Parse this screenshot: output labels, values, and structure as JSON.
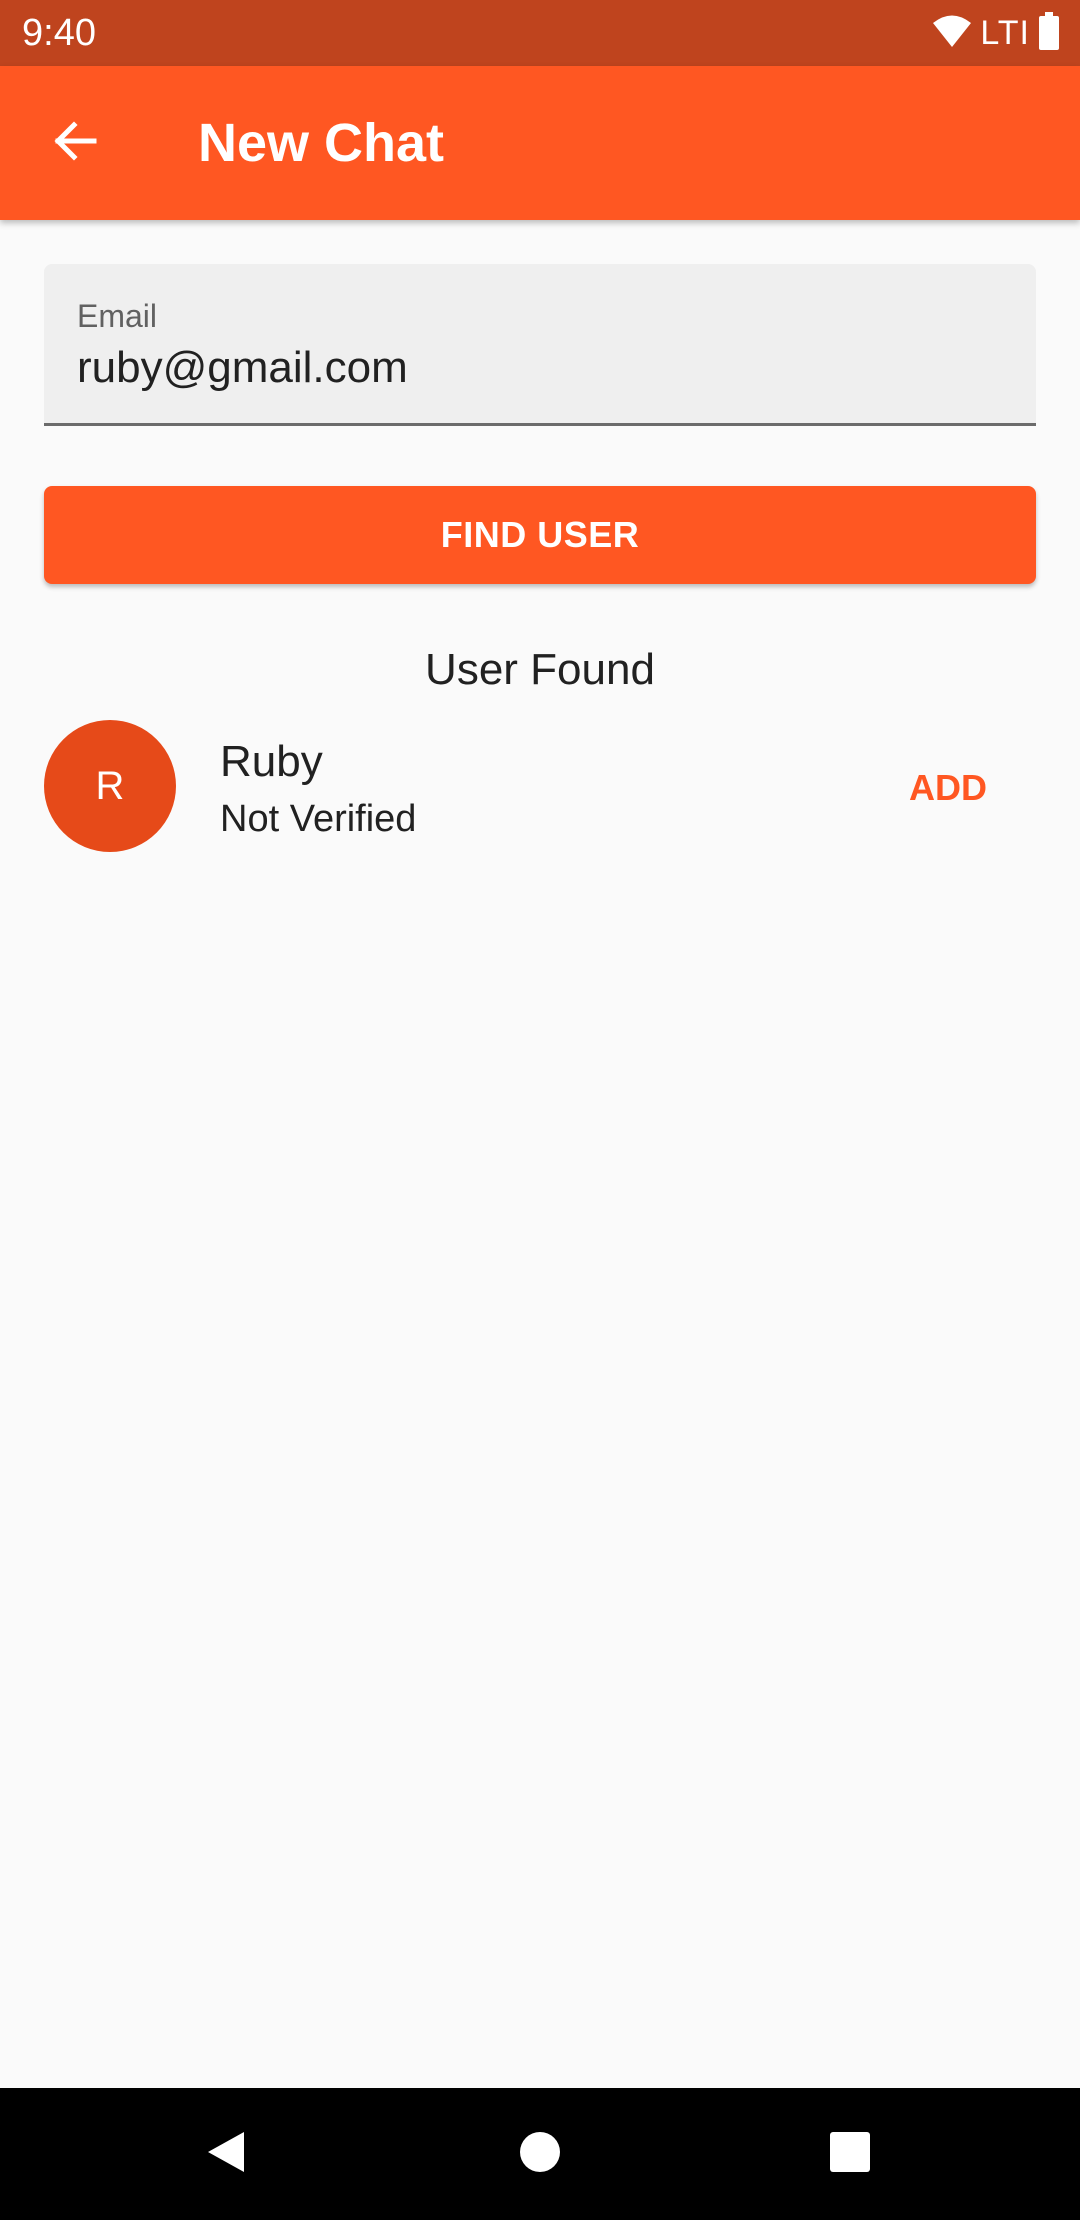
{
  "status_bar": {
    "time": "9:40",
    "network": "LTI"
  },
  "app_bar": {
    "title": "New Chat"
  },
  "email_field": {
    "label": "Email",
    "value": "ruby@gmail.com"
  },
  "find_button": {
    "label": "FIND USER"
  },
  "result": {
    "heading": "User Found",
    "user": {
      "initial": "R",
      "name": "Ruby",
      "status": "Not Verified",
      "action_label": "ADD"
    }
  },
  "colors": {
    "primary": "#ff5722",
    "status_bar": "#bf441e",
    "avatar": "#e64a19",
    "background": "#fafafa"
  },
  "icons": [
    "wifi-icon",
    "battery-icon",
    "back-arrow-icon",
    "nav-back-icon",
    "nav-home-icon",
    "nav-recents-icon"
  ]
}
